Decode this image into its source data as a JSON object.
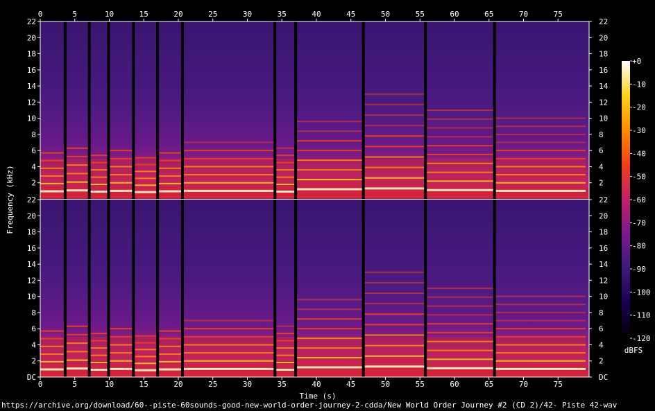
{
  "footer_url": "https://archive.org/download/60--piste-60sounds-good-new-world-order-journey-2-cdda/New World Order Journey #2 (CD 2)/42- Piste 42-wav",
  "chart_data": {
    "type": "heatmap",
    "subtype": "spectrogram",
    "channels": 2,
    "xlabel": "Time (s)",
    "ylabel": "Frequency (kHz)",
    "colorbar_label": "dBFS",
    "xlim": [
      0,
      79.5
    ],
    "ylim_khz": [
      0,
      22
    ],
    "x_ticks": [
      0,
      5,
      10,
      15,
      20,
      25,
      30,
      35,
      40,
      45,
      50,
      55,
      60,
      65,
      70,
      75
    ],
    "y_ticks": [
      "DC",
      2,
      4,
      6,
      8,
      10,
      12,
      14,
      16,
      18,
      20,
      22
    ],
    "colorbar_ticks": [
      "+0",
      -10,
      -20,
      -30,
      -40,
      -50,
      -60,
      -70,
      -80,
      -90,
      -100,
      -110,
      -120
    ],
    "colorbar_range_db": [
      -120,
      0
    ],
    "colormap": [
      "#000000",
      "#1a0050",
      "#3c1a7a",
      "#7a1a8c",
      "#c0206a",
      "#f0401a",
      "#ff8a00",
      "#ffd21a",
      "#ffffff"
    ],
    "silence_gaps_s": [
      3.6,
      7.1,
      9.9,
      13.5,
      17.0,
      20.6,
      34.0,
      37.0,
      46.8,
      55.8,
      65.8
    ],
    "segments": [
      {
        "start": 0.0,
        "end": 3.6,
        "fund_khz": 0.95,
        "harmonics": 6
      },
      {
        "start": 3.6,
        "end": 7.1,
        "fund_khz": 1.05,
        "harmonics": 6
      },
      {
        "start": 7.1,
        "end": 9.9,
        "fund_khz": 0.9,
        "harmonics": 6
      },
      {
        "start": 9.9,
        "end": 13.5,
        "fund_khz": 1.0,
        "harmonics": 6
      },
      {
        "start": 13.5,
        "end": 17.0,
        "fund_khz": 0.85,
        "harmonics": 6
      },
      {
        "start": 17.0,
        "end": 20.6,
        "fund_khz": 0.95,
        "harmonics": 6
      },
      {
        "start": 20.6,
        "end": 34.0,
        "fund_khz": 1.0,
        "harmonics": 7
      },
      {
        "start": 34.0,
        "end": 37.0,
        "fund_khz": 0.9,
        "harmonics": 7
      },
      {
        "start": 37.0,
        "end": 46.8,
        "fund_khz": 1.2,
        "harmonics": 8
      },
      {
        "start": 46.8,
        "end": 55.8,
        "fund_khz": 1.3,
        "harmonics": 10
      },
      {
        "start": 55.8,
        "end": 65.8,
        "fund_khz": 1.1,
        "harmonics": 10
      },
      {
        "start": 65.8,
        "end": 79.0,
        "fund_khz": 1.0,
        "harmonics": 10
      }
    ]
  }
}
